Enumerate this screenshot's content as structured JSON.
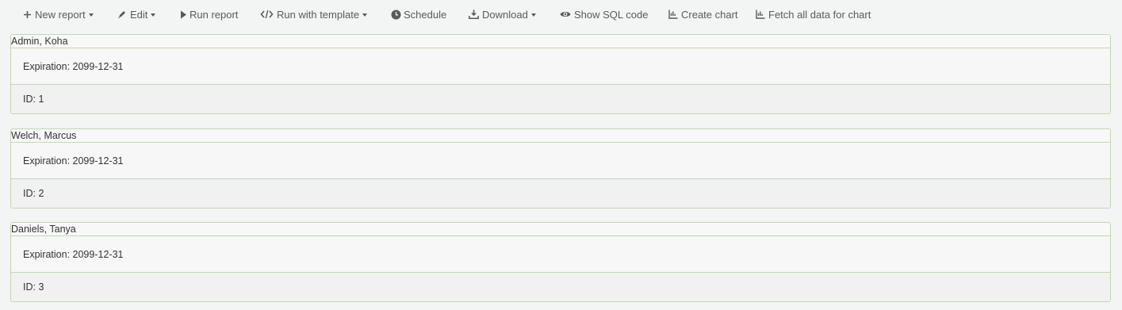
{
  "toolbar": {
    "new_report": "New report",
    "edit": "Edit",
    "run_report": "Run report",
    "run_with_template": "Run with template",
    "schedule": "Schedule",
    "download": "Download",
    "show_sql": "Show SQL code",
    "create_chart": "Create chart",
    "fetch_all": "Fetch all data for chart"
  },
  "icons": {
    "new_report": "plus-icon",
    "edit": "pencil-icon",
    "run_report": "play-icon",
    "run_with_template": "code-icon",
    "schedule": "clock-icon",
    "download": "download-icon",
    "show_sql": "eye-icon",
    "create_chart": "chart-icon",
    "fetch_all": "chart-icon"
  },
  "records": [
    {
      "name": "Admin, Koha",
      "expiration": "Expiration: 2099-12-31",
      "id": "ID: 1"
    },
    {
      "name": "Welch, Marcus",
      "expiration": "Expiration: 2099-12-31",
      "id": "ID: 2"
    },
    {
      "name": "Daniels, Tanya",
      "expiration": "Expiration: 2099-12-31",
      "id": "ID: 3"
    }
  ],
  "colors": {
    "border": "#c4d6b4",
    "toolbar_text": "#595959",
    "background": "#f3f4f4"
  }
}
